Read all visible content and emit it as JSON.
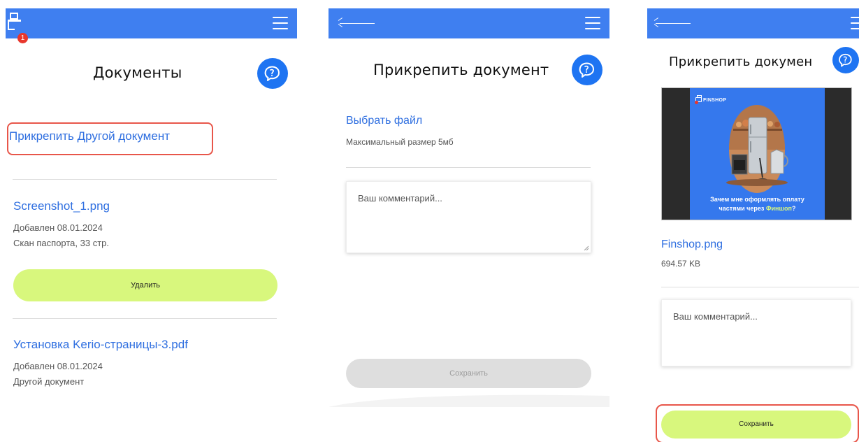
{
  "screens": [
    {
      "title": "Документы",
      "badge_count": "1",
      "attach_link": "Прикрепить Другой документ",
      "documents": [
        {
          "name": "Screenshot_1.png",
          "added": "Добавлен 08.01.2024",
          "description": "Скан паспорта, 33 стр.",
          "delete_label": "Удалить"
        },
        {
          "name": "Установка Kerio-страницы-3.pdf",
          "added": "Добавлен 08.01.2024",
          "description": "Другой документ"
        }
      ]
    },
    {
      "title": "Прикрепить документ",
      "choose_file": "Выбрать файл",
      "max_size": "Максимальный размер 5мб",
      "comment_placeholder": "Ваш комментарий...",
      "save_label": "Сохранить",
      "save_state": "disabled"
    },
    {
      "title": "Прикрепить докумен",
      "preview": {
        "brand": "FINSHOP",
        "caption_line1": "Зачем мне оформлять оплату",
        "caption_line2_prefix": "частями через ",
        "caption_line2_accent": "Финшоп",
        "caption_line2_suffix": "?"
      },
      "file_name": "Finshop.png",
      "file_size": "694.57 KB",
      "comment_placeholder": "Ваш комментарий...",
      "save_label": "Сохранить",
      "save_state": "enabled"
    }
  ],
  "icons": {
    "menu": "hamburger-menu-icon",
    "back": "back-arrow-icon",
    "cart": "shopping-bag-icon",
    "help": "chat-help-icon"
  },
  "colors": {
    "header_blue": "#3f7ff0",
    "help_blue": "#1e74f2",
    "link_blue": "#2f6fe0",
    "button_green": "#d8f77d",
    "button_disabled": "#dedede",
    "badge_red": "#e8372d",
    "highlight_red": "#e8564a"
  }
}
